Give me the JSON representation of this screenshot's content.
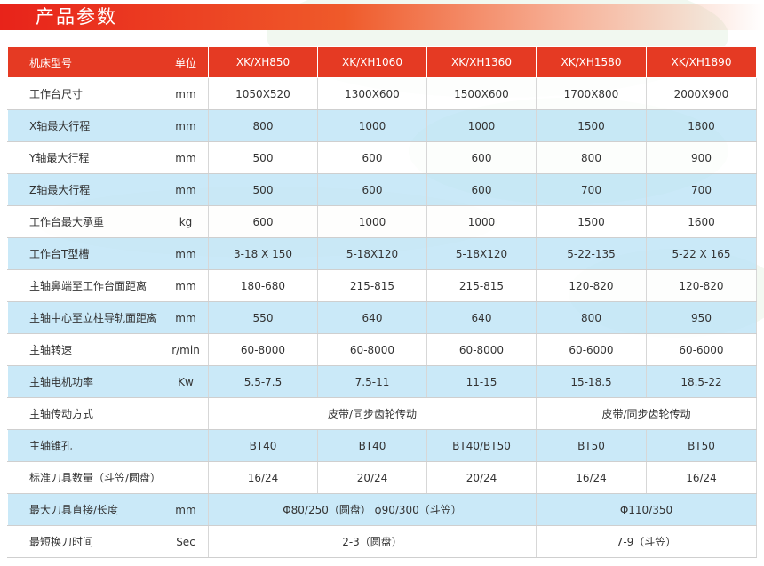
{
  "header": {
    "title": "产品参数"
  },
  "table": {
    "headers": [
      "机床型号",
      "单位",
      "XK/XH850",
      "XK/XH1060",
      "XK/XH1360",
      "XK/XH1580",
      "XK/XH1890"
    ],
    "rows": [
      [
        "工作台尺寸",
        "mm",
        "1050X520",
        "1300X600",
        "1500X600",
        "1700X800",
        "2000X900"
      ],
      [
        "X轴最大行程",
        "mm",
        "800",
        "1000",
        "1000",
        "1500",
        "1800"
      ],
      [
        "Y轴最大行程",
        "mm",
        "500",
        "600",
        "600",
        "800",
        "900"
      ],
      [
        "Z轴最大行程",
        "mm",
        "500",
        "600",
        "600",
        "700",
        "700"
      ],
      [
        "工作台最大承重",
        "kg",
        "600",
        "1000",
        "1000",
        "1500",
        "1600"
      ],
      [
        "工作台T型槽",
        "mm",
        "3-18 X 150",
        "5-18X120",
        "5-18X120",
        "5-22-135",
        "5-22 X 165"
      ],
      [
        "主轴鼻端至工作台面距离",
        "mm",
        "180-680",
        "215-815",
        "215-815",
        "120-820",
        "120-820"
      ],
      [
        "主轴中心至立柱导轨面距离",
        "mm",
        "550",
        "640",
        "640",
        "800",
        "950"
      ],
      [
        "主轴转速",
        "r/min",
        "60-8000",
        "60-8000",
        "60-8000",
        "60-6000",
        "60-6000"
      ],
      [
        "主轴电机功率",
        "Kw",
        "5.5-7.5",
        "7.5-11",
        "11-15",
        "15-18.5",
        "18.5-22"
      ]
    ],
    "drive_row": {
      "label": "主轴传动方式",
      "unit": "",
      "left": "皮带/同步齿轮传动",
      "right": "皮带/同步齿轮传动"
    },
    "taper_row": {
      "label": "主轴锥孔",
      "unit": "",
      "values": [
        "BT40",
        "BT40",
        "BT40/BT50",
        "BT50",
        "BT50"
      ]
    },
    "tools_row": {
      "label": "标准刀具数量（斗笠/圆盘）",
      "unit": "",
      "values": [
        "16/24",
        "20/24",
        "20/24",
        "16/24",
        "16/24"
      ]
    },
    "tool_dim_row": {
      "label": "最大刀具直接/长度",
      "unit": "mm",
      "left": "Φ80/250（圆盘）   ɸ90/300（斗笠）",
      "right": "Φ110/350"
    },
    "change_time_row": {
      "label": "最短换刀时间",
      "unit": "Sec",
      "left": "2-3（圆盘）",
      "right": "7-9（斗笠）"
    }
  }
}
